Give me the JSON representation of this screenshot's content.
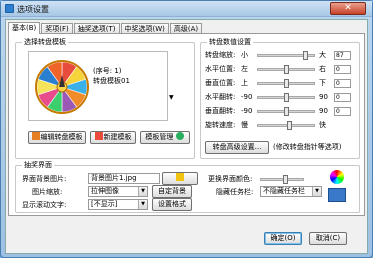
{
  "window": {
    "title": "选项设置",
    "close_glyph": "✕"
  },
  "tabs": [
    {
      "label": "基本(B)",
      "active": true
    },
    {
      "label": "奖项(F)",
      "active": false
    },
    {
      "label": "抽奖选项(T)",
      "active": false
    },
    {
      "label": "中奖选项(W)",
      "active": false
    },
    {
      "label": "高级(A)",
      "active": false
    }
  ],
  "template_group": {
    "title": "选择转盘模板",
    "seq_line": "(序号: 1)",
    "template_name": "转盘模板01",
    "buttons": {
      "edit": "编辑转盘模板",
      "new": "新建模板",
      "manage": "模板管理"
    }
  },
  "wheel_settings": {
    "title": "转盘数值设置",
    "rows": [
      {
        "label": "转盘缩放:",
        "left": "小",
        "right": "大",
        "value": "87",
        "level": 0.87
      },
      {
        "label": "水平位置:",
        "left": "左",
        "right": "右",
        "value": "0",
        "level": 0.5
      },
      {
        "label": "垂直位置:",
        "left": "上",
        "right": "下",
        "value": "0",
        "level": 0.5
      },
      {
        "label": "水平翻转:",
        "left": "-90",
        "right": "90",
        "value": "0",
        "level": 0.5
      },
      {
        "label": "垂直翻转:",
        "left": "-90",
        "right": "90",
        "value": "0",
        "level": 0.5
      },
      {
        "label": "旋转速度:",
        "left": "慢",
        "right": "快",
        "value": "",
        "level": 0.55
      }
    ],
    "advanced_button": "转盘高级设置...",
    "advanced_note": "(修改转盘指针等选项)"
  },
  "lottery_ui": {
    "title": "抽奖界面",
    "bg_label": "界面背景图片:",
    "bg_value": "背景图片1.jpg",
    "scale_label": "图片缩放:",
    "scale_value": "拉伸图像",
    "custom_bg_button": "自定背景",
    "scroll_label": "显示滚动文字:",
    "scroll_value": "[不显示]",
    "set_format_button": "设置格式",
    "color_label": "更换界面颜色:",
    "taskbar_label": "隐藏任务栏:",
    "taskbar_value": "不隐藏任务栏"
  },
  "footer": {
    "ok": "确定(O)",
    "cancel": "取消(C)"
  },
  "colors": {
    "wheel_segments": [
      "#e84c3d",
      "#f6d23b",
      "#3bb0e8",
      "#f08c2a",
      "#9b59b6",
      "#3ccf6e",
      "#e84c8c",
      "#f6e25b",
      "#2a7fd0",
      "#f0642a"
    ]
  }
}
